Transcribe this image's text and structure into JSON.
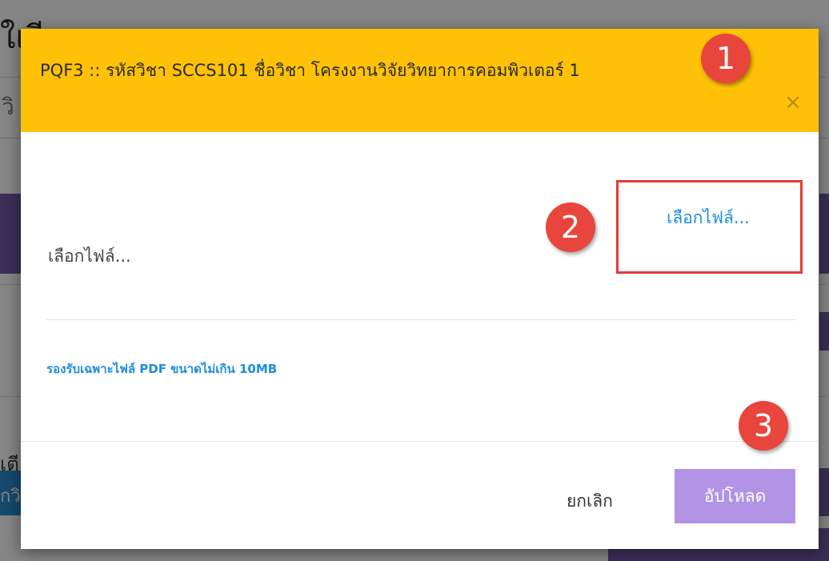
{
  "background_page": {
    "title_fragment": "ใเรียนการสอน",
    "field_fragment": "วิ",
    "side_label_fragment": "เตี",
    "left_button_fragment": "กวิ"
  },
  "modal": {
    "title": "PQF3 :: รหัสวิชา SCCS101 ชื่อวิชา โครงงานวิจัยวิทยาการคอมพิวเตอร์ 1",
    "close_glyph": "×",
    "file_label": "เลือกไฟล์...",
    "file_button_label": "เลือกไฟล์...",
    "hint": "รองรับเฉพาะไฟล์ PDF ขนาดไม่เกิน 10MB",
    "cancel_label": "ยกเลิก",
    "upload_label": "อัปโหลด"
  },
  "callouts": [
    "1",
    "2",
    "3"
  ],
  "colors": {
    "header": "#ffc107",
    "link_blue": "#1d8de0",
    "upload_button": "#b293e6",
    "callout_red": "#e8453c",
    "highlight_box": "#e53935"
  }
}
